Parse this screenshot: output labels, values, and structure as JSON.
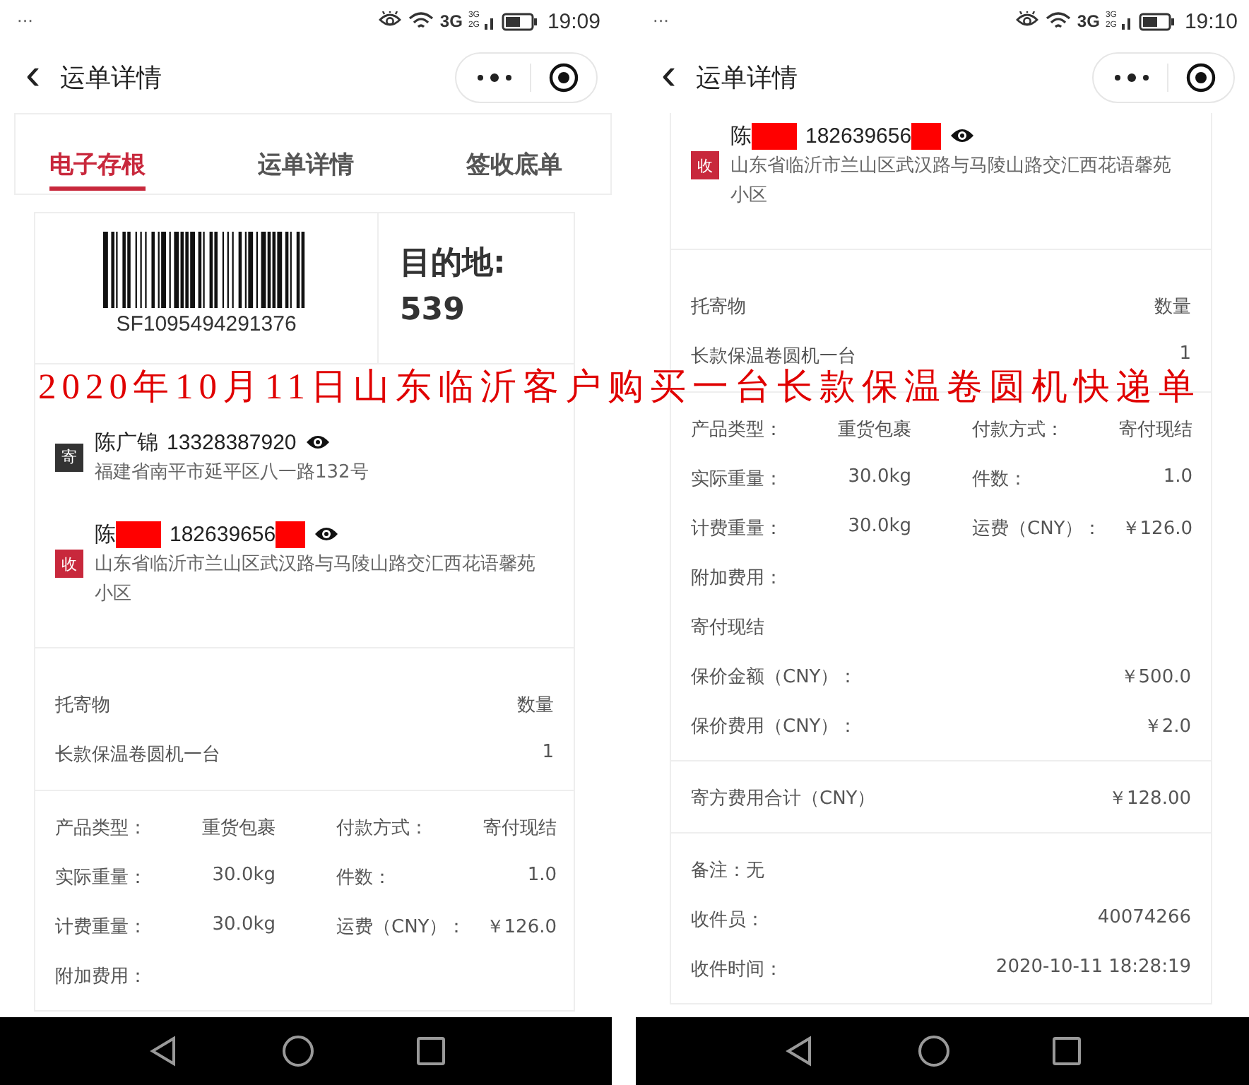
{
  "caption": "2020年10月11日山东临沂客户购买一台长款保温卷圆机快递单",
  "phones": [
    {
      "status_bar": {
        "dots": "···",
        "network": "3G",
        "sim1": "3G",
        "sim2": "2G",
        "time": "19:09"
      },
      "nav": {
        "back": "‹",
        "title": "运单详情"
      },
      "sections": [
        {
          "kind": "tabs",
          "items": [
            {
              "label": "电子存根",
              "selected": true
            },
            {
              "label": "运单详情",
              "selected": false
            },
            {
              "label": "签收底单",
              "selected": false
            }
          ]
        },
        {
          "kind": "waybill",
          "barcode_number": "SF1095494291376",
          "destination_label": "目的地:",
          "destination_code": "539"
        },
        {
          "kind": "parties",
          "items": [
            {
              "kind": "sender",
              "badge": "寄",
              "name": "陈广锦",
              "phone": "13328387920",
              "redacted": false,
              "address": "福建省南平市延平区八一路132号"
            },
            {
              "kind": "receiver",
              "badge": "收",
              "name": "陈",
              "phone": "182639656",
              "redacted": true,
              "address": "山东省临沂市兰山区武汉路与马陵山路交汇西花语馨苑小区"
            }
          ]
        },
        {
          "kind": "goods",
          "rows": [
            [
              {
                "label": "托寄物",
                "value": "数量"
              }
            ],
            [
              {
                "label": "长款保温卷圆机一台",
                "value": "1"
              }
            ]
          ]
        },
        {
          "kind": "details",
          "rows": [
            [
              {
                "label": "产品类型：",
                "value": "重货包裹"
              },
              {
                "label": "付款方式：",
                "value": "寄付现结"
              }
            ],
            [
              {
                "label": "实际重量：",
                "value": "30.0kg"
              },
              {
                "label": "件数：",
                "value": "1.0"
              }
            ],
            [
              {
                "label": "计费重量：",
                "value": "30.0kg"
              },
              {
                "label": "运费（CNY）：",
                "value": "￥126.0"
              }
            ],
            [
              {
                "label": "附加费用："
              }
            ]
          ]
        }
      ]
    },
    {
      "status_bar": {
        "dots": "···",
        "network": "3G",
        "sim1": "3G",
        "sim2": "2G",
        "time": "19:10"
      },
      "nav": {
        "back": "‹",
        "title": "运单详情"
      },
      "sections": [
        {
          "kind": "parties",
          "items": [
            {
              "kind": "receiver",
              "badge": "收",
              "name": "陈",
              "phone": "182639656",
              "redacted": true,
              "address": "山东省临沂市兰山区武汉路与马陵山路交汇西花语馨苑小区"
            }
          ]
        },
        {
          "kind": "goods",
          "rows": [
            [
              {
                "label": "托寄物",
                "value": "数量"
              }
            ],
            [
              {
                "label": "长款保温卷圆机一台",
                "value": "1"
              }
            ]
          ]
        },
        {
          "kind": "details",
          "rows": [
            [
              {
                "label": "产品类型：",
                "value": "重货包裹"
              },
              {
                "label": "付款方式：",
                "value": "寄付现结"
              }
            ],
            [
              {
                "label": "实际重量：",
                "value": "30.0kg"
              },
              {
                "label": "件数：",
                "value": "1.0"
              }
            ],
            [
              {
                "label": "计费重量：",
                "value": "30.0kg"
              },
              {
                "label": "运费（CNY）：",
                "value": "￥126.0"
              }
            ],
            [
              {
                "label": "附加费用："
              }
            ],
            [
              {
                "label": "寄付现结"
              }
            ],
            [
              {
                "label": "保价金额（CNY）：",
                "value": "￥500.0"
              }
            ],
            [
              {
                "label": "保价费用（CNY）：",
                "value": "￥2.0"
              }
            ]
          ]
        },
        {
          "kind": "details",
          "rows": [
            [
              {
                "label": "寄方费用合计（CNY）",
                "value": "￥128.00"
              }
            ]
          ]
        },
        {
          "kind": "details",
          "rows": [
            [
              {
                "label": "备注：无"
              }
            ],
            [
              {
                "label": "收件员：",
                "value": "40074266"
              }
            ],
            [
              {
                "label": "收件时间：",
                "value": "2020-10-11 18:28:19"
              }
            ]
          ]
        }
      ]
    }
  ]
}
